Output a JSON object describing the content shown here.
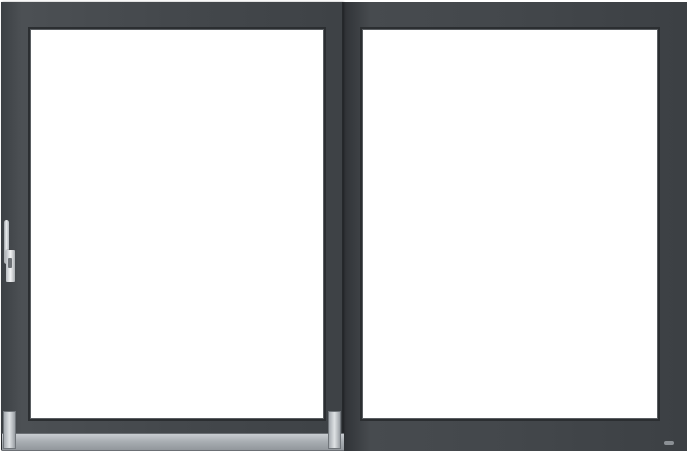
{
  "scene": {
    "subject": "sliding-patio-door",
    "frame_color": "#43474b",
    "glass_color": "#ffffff",
    "hardware_color": "#c9cdd1"
  }
}
